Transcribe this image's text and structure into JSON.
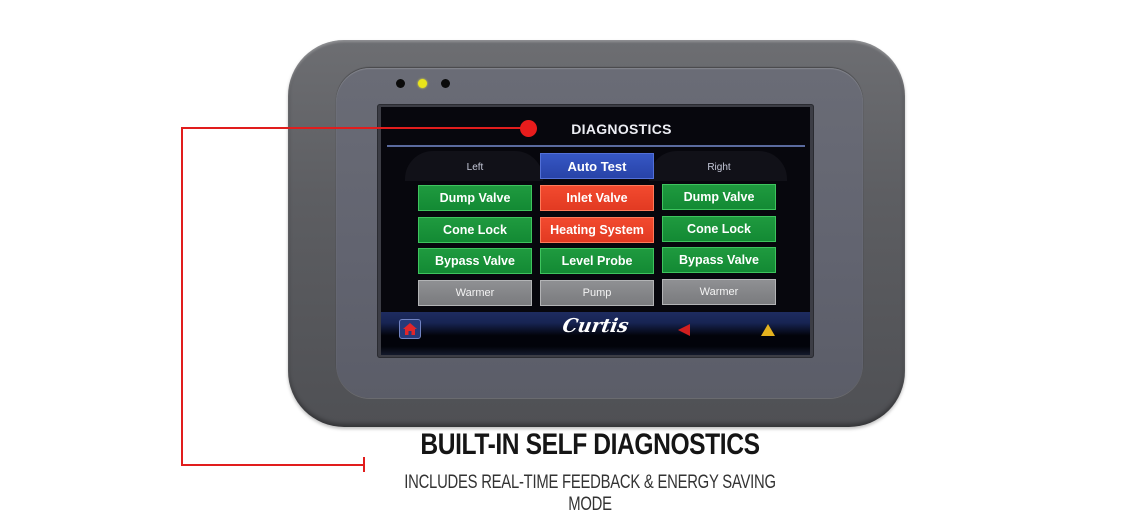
{
  "device": {
    "indicator_leds": [
      {
        "state": "off",
        "color": "#0a0a0a"
      },
      {
        "state": "on",
        "color": "#e9e51a"
      },
      {
        "state": "off",
        "color": "#0a0a0a"
      }
    ]
  },
  "screen": {
    "title": "DIAGNOSTICS",
    "columns": [
      {
        "label": "Left",
        "buttons": [
          {
            "label": "Dump Valve",
            "status": "ok",
            "color": "#1f9a3f"
          },
          {
            "label": "Cone Lock",
            "status": "ok",
            "color": "#1f9a3f"
          },
          {
            "label": "Bypass Valve",
            "status": "ok",
            "color": "#1f9a3f"
          },
          {
            "label": "Warmer",
            "status": "inactive",
            "color": "#8f9093"
          }
        ]
      },
      {
        "label": "Auto Test",
        "buttons": [
          {
            "label": "Inlet Valve",
            "status": "fault",
            "color": "#f24a2f"
          },
          {
            "label": "Heating System",
            "status": "fault",
            "color": "#f24a2f"
          },
          {
            "label": "Level Probe",
            "status": "ok",
            "color": "#1f9a3f"
          },
          {
            "label": "Pump",
            "status": "inactive",
            "color": "#8f9093"
          }
        ]
      },
      {
        "label": "Right",
        "buttons": [
          {
            "label": "Dump Valve",
            "status": "ok",
            "color": "#1f9a3f"
          },
          {
            "label": "Cone Lock",
            "status": "ok",
            "color": "#1f9a3f"
          },
          {
            "label": "Bypass Valve",
            "status": "ok",
            "color": "#1f9a3f"
          },
          {
            "label": "Warmer",
            "status": "inactive",
            "color": "#8f9093"
          }
        ]
      }
    ],
    "footer": {
      "home_icon": "home-icon",
      "logo": "Curtis",
      "back_icon": "back-arrow-icon",
      "warning_icon": "warning-triangle-icon"
    }
  },
  "caption": {
    "title": "BUILT-IN SELF DIAGNOSTICS",
    "subtitle": "INCLUDES REAL-TIME FEEDBACK & ENERGY SAVING MODE"
  },
  "colors": {
    "callout": "#e11d1d",
    "ok": "#1f9a3f",
    "fault": "#f24a2f",
    "action": "#3657c4",
    "inactive": "#8f9093"
  }
}
